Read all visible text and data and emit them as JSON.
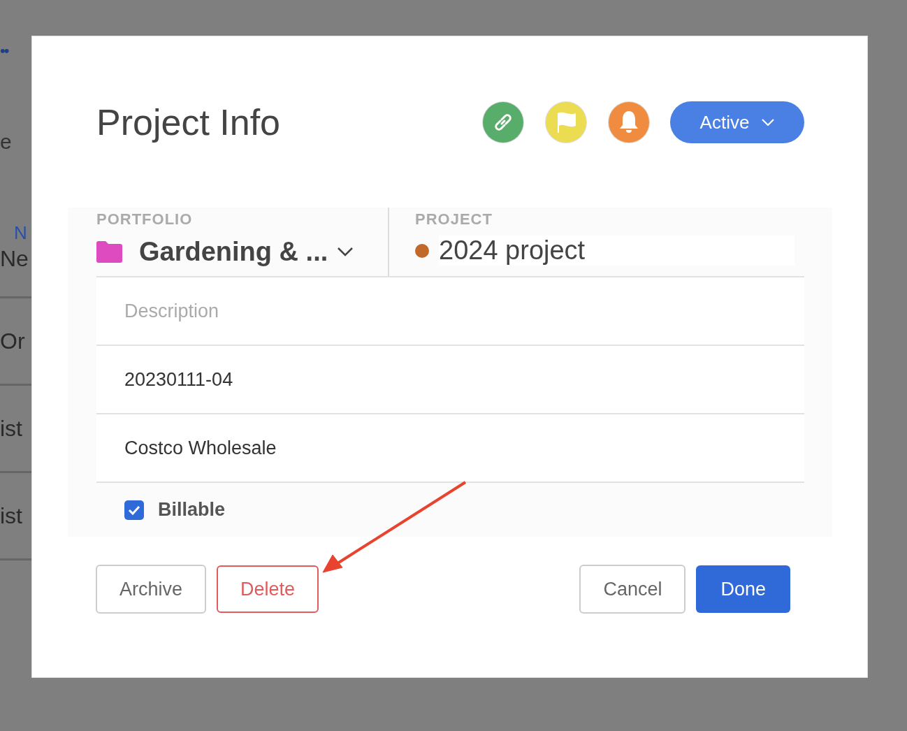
{
  "background": {
    "items": [
      {
        "kind": "dots",
        "text": "••"
      },
      {
        "kind": "text",
        "text": "e"
      },
      {
        "kind": "link",
        "text": "N"
      },
      {
        "kind": "row",
        "text": "Ne"
      },
      {
        "kind": "row",
        "text": "Or"
      },
      {
        "kind": "row",
        "text": "ist"
      },
      {
        "kind": "row",
        "text": "ist"
      }
    ]
  },
  "dialog": {
    "title": "Project Info",
    "quick_actions": [
      {
        "kind": "link",
        "color": "#58ad6a"
      },
      {
        "kind": "flag",
        "color": "#ecdc52"
      },
      {
        "kind": "bell",
        "color": "#f08c3f"
      }
    ],
    "status": "Active",
    "portfolio": {
      "label": "PORTFOLIO",
      "value": "Gardening & ...",
      "color": "#de4bc1"
    },
    "project": {
      "label": "PROJECT",
      "value": "2024 project",
      "color": "#c0692b"
    },
    "description": {
      "placeholder": "Description"
    },
    "fields": [
      {
        "value": "20230111-04"
      },
      {
        "value": "Costco Wholesale"
      }
    ],
    "billable": {
      "label": "Billable",
      "checked": true
    },
    "buttons": [
      {
        "label": "Archive",
        "kind": "secondary"
      },
      {
        "label": "Delete",
        "kind": "danger"
      },
      {
        "label": "Cancel",
        "kind": "secondary"
      },
      {
        "label": "Done",
        "kind": "primary"
      }
    ]
  }
}
